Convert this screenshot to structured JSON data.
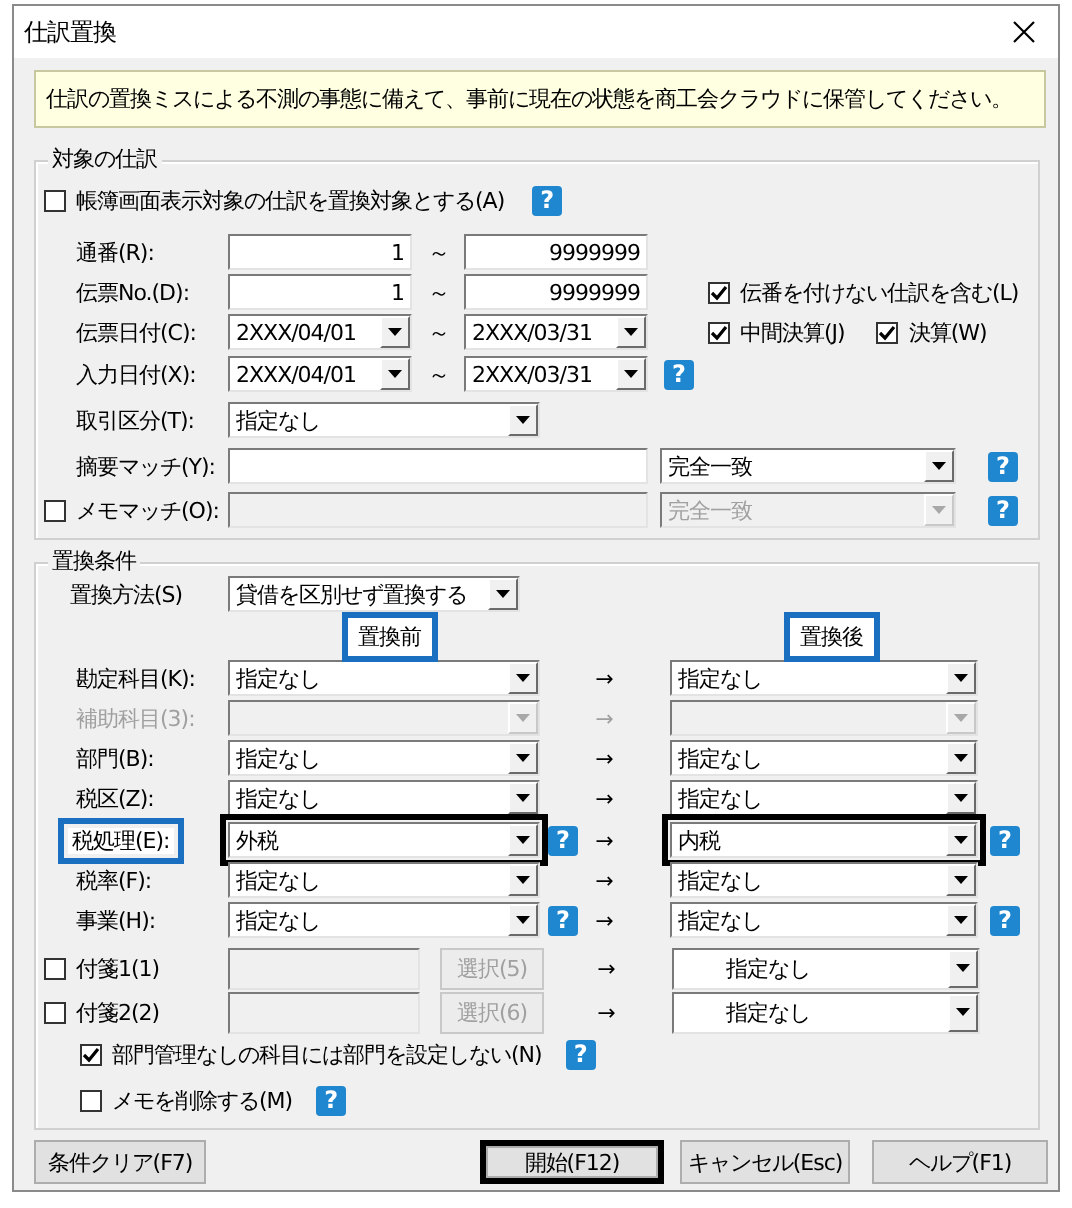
{
  "window": {
    "title": "仕訳置換"
  },
  "notice": "仕訳の置換ミスによる不測の事態に備えて、事前に現在の状態を商工会クラウドに保管してください。",
  "target": {
    "legend": "対象の仕訳",
    "display_target": {
      "label": "帳簿画面表示対象の仕訳を置換対象とする(A)",
      "checked": false,
      "help": "?"
    },
    "ranges": [
      {
        "kind": "text",
        "label": "通番(R):",
        "from": "1",
        "separator": "～",
        "to": "9999999"
      },
      {
        "kind": "text",
        "label": "伝票No.(D):",
        "from": "1",
        "separator": "～",
        "to": "9999999",
        "options": [
          {
            "label": "伝番を付けない仕訳を含む(L)",
            "checked": true
          }
        ]
      },
      {
        "kind": "date",
        "label": "伝票日付(C):",
        "from": "2XXX/04/01",
        "separator": "～",
        "to": "2XXX/03/31",
        "options": [
          {
            "label": "中間決算(J)",
            "checked": true
          },
          {
            "label": "決算(W)",
            "checked": true
          }
        ]
      },
      {
        "kind": "date",
        "label": "入力日付(X):",
        "from": "2XXX/04/01",
        "separator": "～",
        "to": "2XXX/03/31",
        "help": "?"
      }
    ],
    "transaction_type": {
      "label": "取引区分(T):",
      "value": "指定なし"
    },
    "summary_match": {
      "label": "摘要マッチ(Y):",
      "mode": "完全一致",
      "disabled": false,
      "help": "?"
    },
    "memo_match": {
      "label": "メモマッチ(O):",
      "checked": false,
      "mode": "完全一致",
      "disabled": true,
      "help": "?"
    }
  },
  "replace": {
    "legend": "置換条件",
    "method": {
      "label": "置換方法(S)",
      "value": "貸借を区別せず置換する"
    },
    "headers": [
      {
        "text": "置換前",
        "marked": true
      },
      {
        "text": "置換後",
        "marked": true
      }
    ],
    "rows": [
      {
        "kind": "combo",
        "label": "勘定科目(K):",
        "label_marked": false,
        "disabled": false,
        "before": "指定なし",
        "before_marked": false,
        "arrow": "→",
        "after": "指定なし",
        "after_marked": false
      },
      {
        "kind": "combo",
        "label": "補助科目(3):",
        "label_marked": false,
        "disabled": true,
        "before_marked": false,
        "arrow": "→",
        "after_marked": false
      },
      {
        "kind": "combo",
        "label": "部門(B):",
        "label_marked": false,
        "disabled": false,
        "before": "指定なし",
        "before_marked": false,
        "arrow": "→",
        "after": "指定なし",
        "after_marked": false
      },
      {
        "kind": "combo",
        "label": "税区(Z):",
        "label_marked": false,
        "disabled": false,
        "before": "指定なし",
        "before_marked": false,
        "arrow": "→",
        "after": "指定なし",
        "after_marked": false
      },
      {
        "kind": "combo",
        "label": "税処理(E):",
        "label_marked": true,
        "disabled": false,
        "before": "外税",
        "before_marked": true,
        "help_before": "?",
        "arrow": "→",
        "after": "内税",
        "after_marked": true,
        "help_after": "?"
      },
      {
        "kind": "combo",
        "label": "税率(F):",
        "label_marked": false,
        "disabled": false,
        "before": "指定なし",
        "before_marked": false,
        "arrow": "→",
        "after": "指定なし",
        "after_marked": false
      },
      {
        "kind": "combo",
        "label": "事業(H):",
        "label_marked": false,
        "disabled": false,
        "before": "指定なし",
        "before_marked": false,
        "help_before": "?",
        "arrow": "→",
        "after": "指定なし",
        "after_marked": false,
        "help_after": "?"
      },
      {
        "kind": "tag",
        "label": "付箋1(1)",
        "checked": false,
        "disabled": true,
        "select": "選択(5)",
        "arrow": "→",
        "after": "指定なし"
      },
      {
        "kind": "tag",
        "label": "付箋2(2)",
        "checked": false,
        "disabled": true,
        "select": "選択(6)",
        "arrow": "→",
        "after": "指定なし"
      }
    ],
    "options": [
      {
        "label": "部門管理なしの科目には部門を設定しない(N)",
        "checked": true,
        "help": "?"
      },
      {
        "label": "メモを削除する(M)",
        "checked": false,
        "help": "?"
      }
    ]
  },
  "buttons": [
    {
      "label": "条件クリア(F7)",
      "marked": false
    },
    {
      "label": "開始(F12)",
      "marked": true
    },
    {
      "label": "キャンセル(Esc)",
      "marked": false
    },
    {
      "label": "ヘルプ(F1)",
      "marked": false
    }
  ]
}
